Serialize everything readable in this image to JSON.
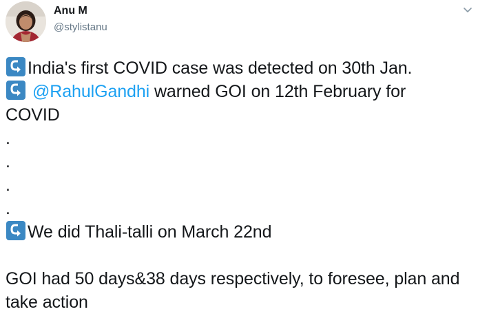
{
  "author": {
    "display_name": "Anu M",
    "handle": "@stylistanu"
  },
  "icons": {
    "more": "chevron-down-icon",
    "bullet": "leftwards-arrow-with-hook-emoji",
    "avatar": "profile-photo"
  },
  "colors": {
    "mention": "#1da1f2",
    "emoji_bg": "#3b88c3",
    "handle": "#657786"
  },
  "tweet": {
    "line1": "India's first COVID case was detected on 30th Jan.",
    "line2_mention": "@RahulGandhi",
    "line2_rest": " warned GOI on 12th February for",
    "line2_cont": "COVID",
    "dots": [
      ".",
      ".",
      ".",
      "."
    ],
    "line3": "We did Thali-talli on March 22nd",
    "conclusion": "GOI had 50 days&38 days respectively, to foresee, plan and take action"
  }
}
